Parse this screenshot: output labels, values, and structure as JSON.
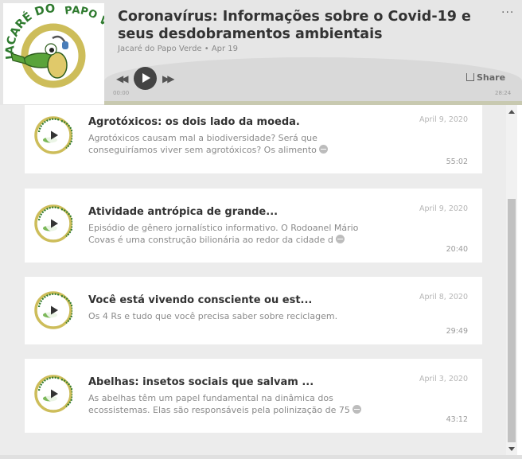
{
  "player": {
    "title": "Coronavírus: Informações sobre o Covid-19 e seus desdobramentos ambientais",
    "meta": "Jacaré do Papo Verde • Apr 19",
    "more_label": "···",
    "share_label": "Share",
    "time_start": "00:00",
    "time_end": "28:24",
    "progress": 0
  },
  "logo": {
    "text_top": "JACARÉ DO",
    "text_right": "PAPO VERDE",
    "colors": {
      "ring": "#cdbd5a",
      "text": "#2e7a2e",
      "gator": "#5aa33a"
    }
  },
  "episodes": [
    {
      "title": "Agrotóxicos: os dois lado da moeda.",
      "date": "April 9, 2020",
      "desc": "Agrotóxicos causam mal a biodiversidade? Será que conseguiríamos viver sem agrotóxicos? Os alimento",
      "duration": "55:02",
      "has_more": true
    },
    {
      "title": "Atividade antrópica de grande...",
      "date": "April 9, 2020",
      "desc": "Episódio de gênero jornalístico informativo. O Rodoanel Mário Covas é uma construção bilionária ao redor da cidade d",
      "duration": "20:40",
      "has_more": true
    },
    {
      "title": "Você está vivendo consciente ou est...",
      "date": "April 8, 2020",
      "desc": "Os 4 Rs e tudo que você precisa saber sobre reciclagem.",
      "duration": "29:49",
      "has_more": false
    },
    {
      "title": "Abelhas: insetos sociais que salvam ...",
      "date": "April 3, 2020",
      "desc": "As abelhas têm um papel fundamental na dinâmica dos ecossistemas. Elas são responsáveis pela polinização de 75",
      "duration": "43:12",
      "has_more": true
    }
  ]
}
